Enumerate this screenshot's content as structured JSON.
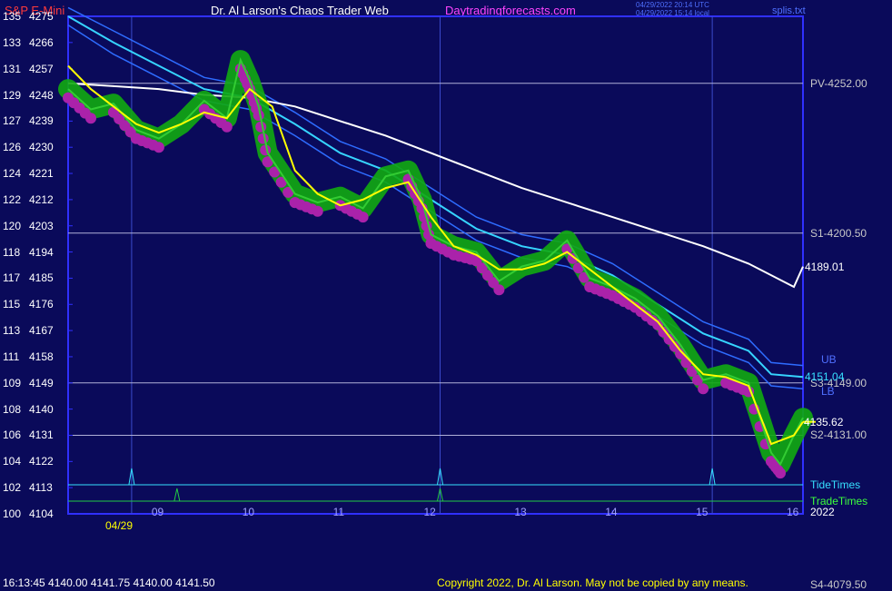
{
  "header": {
    "instrument": "S&P E-Mini",
    "site_title": "Dr. Al Larson's Chaos Trader Web",
    "site_url": "Daytradingforecasts.com",
    "timestamp_utc": "04/29/2022 20:14 UTC",
    "timestamp_local": "04/29/2022 15:14 local",
    "filename": "splis.txt"
  },
  "footer": {
    "readout": "16:13:45  4140.00 4141.75 4140.00 4141.50",
    "copyright": "Copyright 2022, Dr. Al Larson. May not be copied by any means.",
    "s4_label": "S4-4079.50"
  },
  "chart_data": {
    "type": "line",
    "title": "S&P E-Mini",
    "date_label": "04/29",
    "year_label": "2022",
    "ylim": [
      4104,
      4275
    ],
    "y_ticks": [
      {
        "left": "135",
        "right": "4275"
      },
      {
        "left": "133",
        "right": "4266"
      },
      {
        "left": "131",
        "right": "4257"
      },
      {
        "left": "129",
        "right": "4248"
      },
      {
        "left": "127",
        "right": "4239"
      },
      {
        "left": "126",
        "right": "4230"
      },
      {
        "left": "124",
        "right": "4221"
      },
      {
        "left": "122",
        "right": "4212"
      },
      {
        "left": "120",
        "right": "4203"
      },
      {
        "left": "118",
        "right": "4194"
      },
      {
        "left": "117",
        "right": "4185"
      },
      {
        "left": "115",
        "right": "4176"
      },
      {
        "left": "113",
        "right": "4167"
      },
      {
        "left": "111",
        "right": "4158"
      },
      {
        "left": "109",
        "right": "4149"
      },
      {
        "left": "108",
        "right": "4140"
      },
      {
        "left": "106",
        "right": "4131"
      },
      {
        "left": "104",
        "right": "4122"
      },
      {
        "left": "102",
        "right": "4113"
      },
      {
        "left": "100",
        "right": "4104"
      }
    ],
    "xlim": [
      8.0,
      16.1
    ],
    "x_ticks": [
      "09",
      "10",
      "11",
      "12",
      "13",
      "14",
      "15",
      "16"
    ],
    "pivot_levels": [
      {
        "label": "PV-4252.00",
        "value": 4252.0
      },
      {
        "label": "S1-4200.50",
        "value": 4200.5
      },
      {
        "label": "S3-4149.00",
        "value": 4149.0
      },
      {
        "label": "S2-4131.00",
        "value": 4131.0
      }
    ],
    "series": [
      {
        "values": [
          [
            8.0,
            4250
          ],
          [
            8.25,
            4243
          ],
          [
            8.5,
            4245
          ],
          [
            8.75,
            4236
          ],
          [
            9.0,
            4233
          ],
          [
            9.25,
            4238
          ],
          [
            9.5,
            4246
          ],
          [
            9.75,
            4240
          ],
          [
            9.9,
            4260
          ],
          [
            10.0,
            4253
          ],
          [
            10.1,
            4244
          ],
          [
            10.2,
            4228
          ],
          [
            10.5,
            4214
          ],
          [
            10.75,
            4211
          ],
          [
            11.0,
            4213
          ],
          [
            11.25,
            4209
          ],
          [
            11.5,
            4220
          ],
          [
            11.75,
            4222
          ],
          [
            11.9,
            4212
          ],
          [
            12.0,
            4200
          ],
          [
            12.25,
            4196
          ],
          [
            12.5,
            4194
          ],
          [
            12.75,
            4184
          ],
          [
            13.0,
            4189
          ],
          [
            13.25,
            4191
          ],
          [
            13.5,
            4198
          ],
          [
            13.75,
            4185
          ],
          [
            14.0,
            4182
          ],
          [
            14.25,
            4178
          ],
          [
            14.5,
            4172
          ],
          [
            14.75,
            4162
          ],
          [
            15.0,
            4150
          ],
          [
            15.25,
            4152
          ],
          [
            15.5,
            4149
          ],
          [
            15.75,
            4125
          ],
          [
            15.85,
            4121
          ],
          [
            16.0,
            4131
          ],
          [
            16.1,
            4137
          ]
        ]
      },
      {
        "values": [
          [
            8.0,
            4258
          ],
          [
            8.25,
            4250
          ],
          [
            8.5,
            4244
          ],
          [
            8.75,
            4238
          ],
          [
            9.0,
            4235
          ],
          [
            9.25,
            4238
          ],
          [
            9.5,
            4242
          ],
          [
            9.75,
            4240
          ],
          [
            10.0,
            4250
          ],
          [
            10.25,
            4244
          ],
          [
            10.5,
            4222
          ],
          [
            10.75,
            4214
          ],
          [
            11.0,
            4210
          ],
          [
            11.25,
            4212
          ],
          [
            11.5,
            4216
          ],
          [
            11.75,
            4218
          ],
          [
            12.0,
            4206
          ],
          [
            12.25,
            4196
          ],
          [
            12.5,
            4193
          ],
          [
            12.75,
            4188
          ],
          [
            13.0,
            4188
          ],
          [
            13.25,
            4190
          ],
          [
            13.5,
            4194
          ],
          [
            13.75,
            4188
          ],
          [
            14.0,
            4182
          ],
          [
            14.25,
            4176
          ],
          [
            14.5,
            4170
          ],
          [
            14.75,
            4160
          ],
          [
            15.0,
            4152
          ],
          [
            15.25,
            4151
          ],
          [
            15.5,
            4148
          ],
          [
            15.75,
            4128
          ],
          [
            16.0,
            4131
          ],
          [
            16.1,
            4135.62
          ]
        ]
      },
      {
        "values": [
          [
            8.0,
            4252
          ],
          [
            8.5,
            4251
          ],
          [
            9.0,
            4250
          ],
          [
            9.5,
            4248
          ],
          [
            10.0,
            4247
          ],
          [
            10.5,
            4244
          ],
          [
            11.0,
            4239
          ],
          [
            11.5,
            4234
          ],
          [
            12.0,
            4228
          ],
          [
            12.5,
            4222
          ],
          [
            13.0,
            4216
          ],
          [
            13.5,
            4211
          ],
          [
            14.0,
            4206
          ],
          [
            14.5,
            4201
          ],
          [
            15.0,
            4196
          ],
          [
            15.5,
            4190
          ],
          [
            16.0,
            4182
          ],
          [
            16.1,
            4189.01
          ]
        ]
      },
      {
        "values": [
          [
            8.0,
            4275
          ],
          [
            8.5,
            4266
          ],
          [
            9.0,
            4258
          ],
          [
            9.5,
            4250
          ],
          [
            10.0,
            4247
          ],
          [
            10.5,
            4238
          ],
          [
            11.0,
            4228
          ],
          [
            11.5,
            4222
          ],
          [
            12.0,
            4212
          ],
          [
            12.5,
            4202
          ],
          [
            13.0,
            4196
          ],
          [
            13.5,
            4193
          ],
          [
            14.0,
            4186
          ],
          [
            14.5,
            4176
          ],
          [
            15.0,
            4166
          ],
          [
            15.5,
            4160
          ],
          [
            15.75,
            4152
          ],
          [
            16.1,
            4151.04
          ]
        ]
      },
      {
        "values": [
          [
            8.0,
            4278
          ],
          [
            8.5,
            4270
          ],
          [
            9.0,
            4262
          ],
          [
            9.5,
            4254
          ],
          [
            10.0,
            4251
          ],
          [
            10.5,
            4242
          ],
          [
            11.0,
            4232
          ],
          [
            11.5,
            4226
          ],
          [
            12.0,
            4216
          ],
          [
            12.5,
            4206
          ],
          [
            13.0,
            4200
          ],
          [
            13.5,
            4197
          ],
          [
            14.0,
            4190
          ],
          [
            14.5,
            4180
          ],
          [
            15.0,
            4170
          ],
          [
            15.5,
            4164
          ],
          [
            15.75,
            4156
          ],
          [
            16.1,
            4155
          ]
        ]
      },
      {
        "values": [
          [
            8.0,
            4272
          ],
          [
            8.5,
            4262
          ],
          [
            9.0,
            4254
          ],
          [
            9.5,
            4246
          ],
          [
            10.0,
            4243
          ],
          [
            10.5,
            4234
          ],
          [
            11.0,
            4224
          ],
          [
            11.5,
            4218
          ],
          [
            12.0,
            4208
          ],
          [
            12.5,
            4198
          ],
          [
            13.0,
            4192
          ],
          [
            13.5,
            4189
          ],
          [
            14.0,
            4182
          ],
          [
            14.5,
            4172
          ],
          [
            15.0,
            4162
          ],
          [
            15.5,
            4156
          ],
          [
            15.75,
            4148
          ],
          [
            16.1,
            4147
          ]
        ]
      }
    ],
    "end_labels": {
      "price_last": "4135.62",
      "ma_white": "4189.01",
      "ma_cyan": "4151.04",
      "ub": "UB",
      "lb": "LB"
    },
    "tide_times": {
      "label": "TideTimes",
      "spikes": [
        8.7,
        12.1,
        15.1
      ]
    },
    "trade_times": {
      "label": "TradeTimes",
      "spikes": [
        9.2,
        12.1
      ]
    },
    "vertical_markers": [
      8.7,
      12.1,
      15.1
    ],
    "colors": {
      "background": "#0a0a5a",
      "frame": "#3030ff",
      "price": "#33cc33",
      "glow": "#11aa11",
      "low_dots": "#aa22aa",
      "signal": "#ffff00",
      "ma_white": "#ffffff",
      "ma_cyan": "#36d4ff",
      "band": "#2e6cff",
      "tide": "#36e0ff",
      "trade": "#22cc44",
      "pivot": "#b0b0d8"
    }
  }
}
